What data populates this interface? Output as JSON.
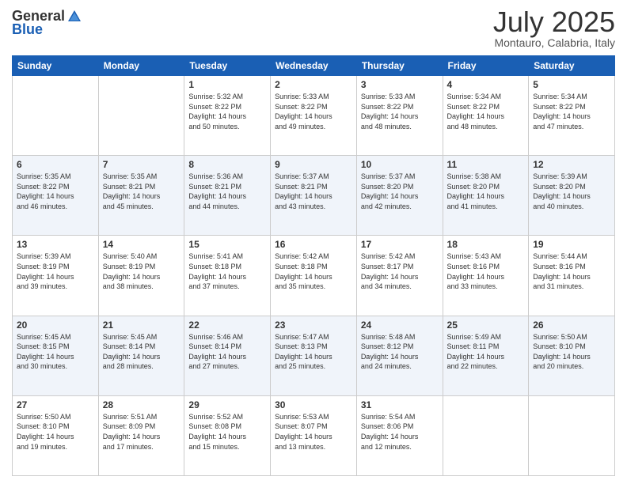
{
  "logo": {
    "general": "General",
    "blue": "Blue"
  },
  "title": "July 2025",
  "subtitle": "Montauro, Calabria, Italy",
  "headers": [
    "Sunday",
    "Monday",
    "Tuesday",
    "Wednesday",
    "Thursday",
    "Friday",
    "Saturday"
  ],
  "weeks": [
    [
      {
        "day": "",
        "info": ""
      },
      {
        "day": "",
        "info": ""
      },
      {
        "day": "1",
        "info": "Sunrise: 5:32 AM\nSunset: 8:22 PM\nDaylight: 14 hours\nand 50 minutes."
      },
      {
        "day": "2",
        "info": "Sunrise: 5:33 AM\nSunset: 8:22 PM\nDaylight: 14 hours\nand 49 minutes."
      },
      {
        "day": "3",
        "info": "Sunrise: 5:33 AM\nSunset: 8:22 PM\nDaylight: 14 hours\nand 48 minutes."
      },
      {
        "day": "4",
        "info": "Sunrise: 5:34 AM\nSunset: 8:22 PM\nDaylight: 14 hours\nand 48 minutes."
      },
      {
        "day": "5",
        "info": "Sunrise: 5:34 AM\nSunset: 8:22 PM\nDaylight: 14 hours\nand 47 minutes."
      }
    ],
    [
      {
        "day": "6",
        "info": "Sunrise: 5:35 AM\nSunset: 8:22 PM\nDaylight: 14 hours\nand 46 minutes."
      },
      {
        "day": "7",
        "info": "Sunrise: 5:35 AM\nSunset: 8:21 PM\nDaylight: 14 hours\nand 45 minutes."
      },
      {
        "day": "8",
        "info": "Sunrise: 5:36 AM\nSunset: 8:21 PM\nDaylight: 14 hours\nand 44 minutes."
      },
      {
        "day": "9",
        "info": "Sunrise: 5:37 AM\nSunset: 8:21 PM\nDaylight: 14 hours\nand 43 minutes."
      },
      {
        "day": "10",
        "info": "Sunrise: 5:37 AM\nSunset: 8:20 PM\nDaylight: 14 hours\nand 42 minutes."
      },
      {
        "day": "11",
        "info": "Sunrise: 5:38 AM\nSunset: 8:20 PM\nDaylight: 14 hours\nand 41 minutes."
      },
      {
        "day": "12",
        "info": "Sunrise: 5:39 AM\nSunset: 8:20 PM\nDaylight: 14 hours\nand 40 minutes."
      }
    ],
    [
      {
        "day": "13",
        "info": "Sunrise: 5:39 AM\nSunset: 8:19 PM\nDaylight: 14 hours\nand 39 minutes."
      },
      {
        "day": "14",
        "info": "Sunrise: 5:40 AM\nSunset: 8:19 PM\nDaylight: 14 hours\nand 38 minutes."
      },
      {
        "day": "15",
        "info": "Sunrise: 5:41 AM\nSunset: 8:18 PM\nDaylight: 14 hours\nand 37 minutes."
      },
      {
        "day": "16",
        "info": "Sunrise: 5:42 AM\nSunset: 8:18 PM\nDaylight: 14 hours\nand 35 minutes."
      },
      {
        "day": "17",
        "info": "Sunrise: 5:42 AM\nSunset: 8:17 PM\nDaylight: 14 hours\nand 34 minutes."
      },
      {
        "day": "18",
        "info": "Sunrise: 5:43 AM\nSunset: 8:16 PM\nDaylight: 14 hours\nand 33 minutes."
      },
      {
        "day": "19",
        "info": "Sunrise: 5:44 AM\nSunset: 8:16 PM\nDaylight: 14 hours\nand 31 minutes."
      }
    ],
    [
      {
        "day": "20",
        "info": "Sunrise: 5:45 AM\nSunset: 8:15 PM\nDaylight: 14 hours\nand 30 minutes."
      },
      {
        "day": "21",
        "info": "Sunrise: 5:45 AM\nSunset: 8:14 PM\nDaylight: 14 hours\nand 28 minutes."
      },
      {
        "day": "22",
        "info": "Sunrise: 5:46 AM\nSunset: 8:14 PM\nDaylight: 14 hours\nand 27 minutes."
      },
      {
        "day": "23",
        "info": "Sunrise: 5:47 AM\nSunset: 8:13 PM\nDaylight: 14 hours\nand 25 minutes."
      },
      {
        "day": "24",
        "info": "Sunrise: 5:48 AM\nSunset: 8:12 PM\nDaylight: 14 hours\nand 24 minutes."
      },
      {
        "day": "25",
        "info": "Sunrise: 5:49 AM\nSunset: 8:11 PM\nDaylight: 14 hours\nand 22 minutes."
      },
      {
        "day": "26",
        "info": "Sunrise: 5:50 AM\nSunset: 8:10 PM\nDaylight: 14 hours\nand 20 minutes."
      }
    ],
    [
      {
        "day": "27",
        "info": "Sunrise: 5:50 AM\nSunset: 8:10 PM\nDaylight: 14 hours\nand 19 minutes."
      },
      {
        "day": "28",
        "info": "Sunrise: 5:51 AM\nSunset: 8:09 PM\nDaylight: 14 hours\nand 17 minutes."
      },
      {
        "day": "29",
        "info": "Sunrise: 5:52 AM\nSunset: 8:08 PM\nDaylight: 14 hours\nand 15 minutes."
      },
      {
        "day": "30",
        "info": "Sunrise: 5:53 AM\nSunset: 8:07 PM\nDaylight: 14 hours\nand 13 minutes."
      },
      {
        "day": "31",
        "info": "Sunrise: 5:54 AM\nSunset: 8:06 PM\nDaylight: 14 hours\nand 12 minutes."
      },
      {
        "day": "",
        "info": ""
      },
      {
        "day": "",
        "info": ""
      }
    ]
  ]
}
